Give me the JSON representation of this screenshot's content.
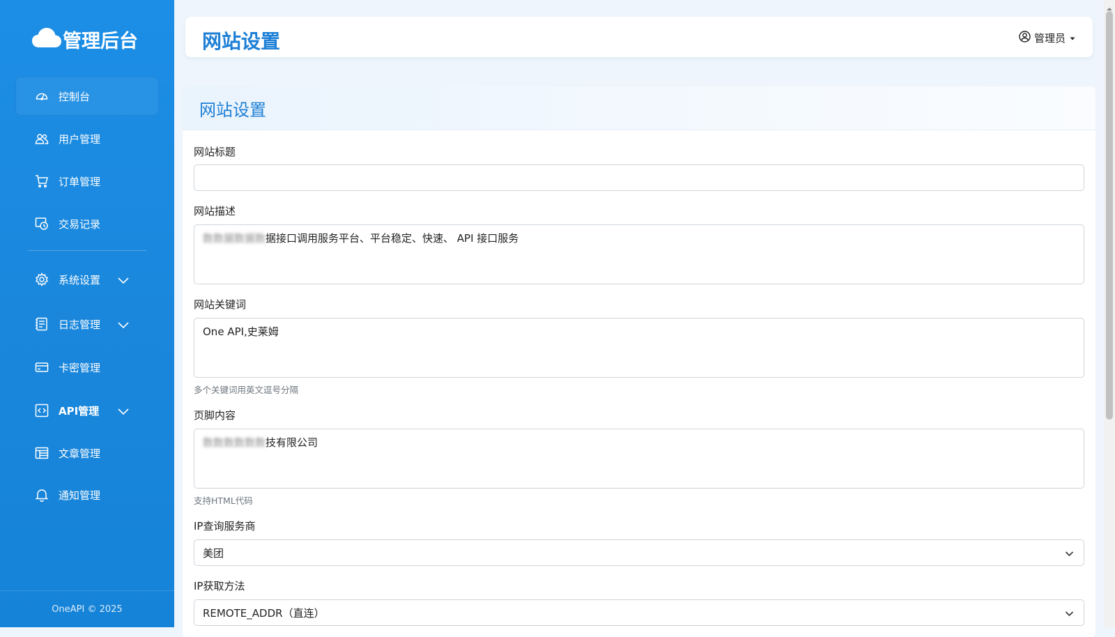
{
  "sidebar": {
    "brand": "管理后台",
    "items": [
      {
        "label": "控制台",
        "icon": "dashboard-icon"
      },
      {
        "label": "用户管理",
        "icon": "users-icon"
      },
      {
        "label": "订单管理",
        "icon": "cart-icon"
      },
      {
        "label": "交易记录",
        "icon": "transaction-icon"
      },
      {
        "label": "系统设置",
        "icon": "gear-icon"
      },
      {
        "label": "日志管理",
        "icon": "log-icon"
      },
      {
        "label": "卡密管理",
        "icon": "card-icon"
      },
      {
        "label": "API管理",
        "icon": "api-icon"
      },
      {
        "label": "文章管理",
        "icon": "article-icon"
      },
      {
        "label": "通知管理",
        "icon": "bell-icon"
      }
    ],
    "footer": "OneAPI © 2025"
  },
  "header": {
    "title": "网站设置",
    "user": "管理员"
  },
  "card": {
    "title": "网站设置"
  },
  "form": {
    "site_title": {
      "label": "网站标题",
      "value": ""
    },
    "site_desc": {
      "label": "网站描述",
      "value": "据接口调用服务平台、平台稳定、快速、 API 接口服务"
    },
    "site_keywords": {
      "label": "网站关键词",
      "value": "One API,史莱姆",
      "help": "多个关键词用英文逗号分隔"
    },
    "footer_content": {
      "label": "页脚内容",
      "value": "技有限公司",
      "help": "支持HTML代码"
    },
    "ip_provider": {
      "label": "IP查询服务商",
      "value": "美团"
    },
    "ip_method": {
      "label": "IP获取方法",
      "value": "REMOTE_ADDR（直连）"
    }
  },
  "colors": {
    "sidebar": "#1a87dc",
    "accent": "#1d7fd6",
    "background": "#eef5fc"
  }
}
